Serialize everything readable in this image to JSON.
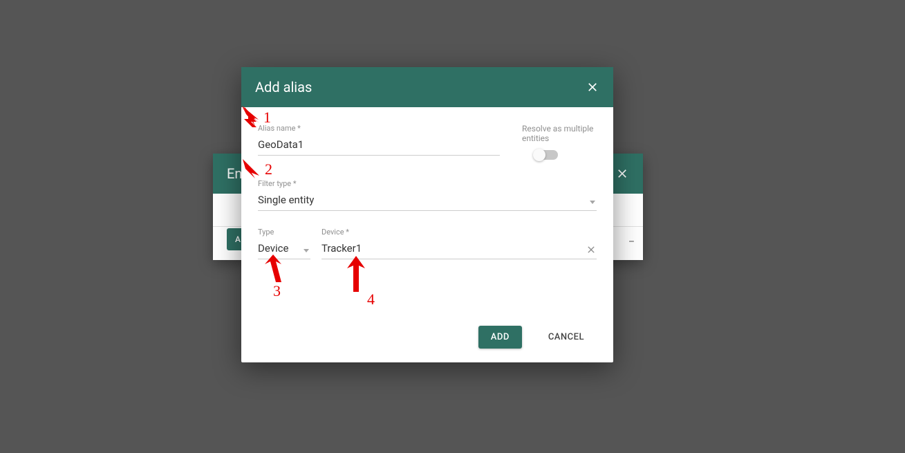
{
  "bgDialog": {
    "title": "Entity aliases",
    "titleVisible": "Enti",
    "addButton": "AD",
    "addButtonFull": "ADD ALIAS"
  },
  "fgDialog": {
    "title": "Add alias",
    "aliasName": {
      "label": "Alias name *",
      "value": "GeoData1"
    },
    "resolve": {
      "label": "Resolve as multiple entities",
      "on": false
    },
    "filterType": {
      "label": "Filter type *",
      "value": "Single entity"
    },
    "type": {
      "label": "Type",
      "value": "Device"
    },
    "device": {
      "label": "Device *",
      "value": "Tracker1"
    },
    "buttons": {
      "add": "ADD",
      "cancel": "CANCEL"
    }
  },
  "annotations": {
    "n1": "1",
    "n2": "2",
    "n3": "3",
    "n4": "4"
  }
}
